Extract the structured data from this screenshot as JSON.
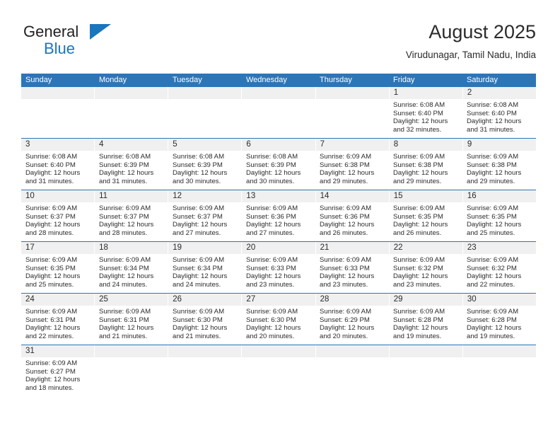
{
  "brand": {
    "name_part1": "General",
    "name_part2": "Blue",
    "triangle_color": "#1a76bc"
  },
  "header": {
    "title": "August 2025",
    "subtitle": "Virudunagar, Tamil Nadu, India"
  },
  "theme": {
    "header_blue": "#2e75b6",
    "date_band_gray": "#f0f0f0",
    "text": "#2b2b2b"
  },
  "weekdays": [
    "Sunday",
    "Monday",
    "Tuesday",
    "Wednesday",
    "Thursday",
    "Friday",
    "Saturday"
  ],
  "weeks": [
    {
      "days": [
        {
          "date": "",
          "sunrise": "",
          "sunset": "",
          "daylight_line1": "",
          "daylight_line2": ""
        },
        {
          "date": "",
          "sunrise": "",
          "sunset": "",
          "daylight_line1": "",
          "daylight_line2": ""
        },
        {
          "date": "",
          "sunrise": "",
          "sunset": "",
          "daylight_line1": "",
          "daylight_line2": ""
        },
        {
          "date": "",
          "sunrise": "",
          "sunset": "",
          "daylight_line1": "",
          "daylight_line2": ""
        },
        {
          "date": "",
          "sunrise": "",
          "sunset": "",
          "daylight_line1": "",
          "daylight_line2": ""
        },
        {
          "date": "1",
          "sunrise": "Sunrise: 6:08 AM",
          "sunset": "Sunset: 6:40 PM",
          "daylight_line1": "Daylight: 12 hours",
          "daylight_line2": "and 32 minutes."
        },
        {
          "date": "2",
          "sunrise": "Sunrise: 6:08 AM",
          "sunset": "Sunset: 6:40 PM",
          "daylight_line1": "Daylight: 12 hours",
          "daylight_line2": "and 31 minutes."
        }
      ]
    },
    {
      "days": [
        {
          "date": "3",
          "sunrise": "Sunrise: 6:08 AM",
          "sunset": "Sunset: 6:40 PM",
          "daylight_line1": "Daylight: 12 hours",
          "daylight_line2": "and 31 minutes."
        },
        {
          "date": "4",
          "sunrise": "Sunrise: 6:08 AM",
          "sunset": "Sunset: 6:39 PM",
          "daylight_line1": "Daylight: 12 hours",
          "daylight_line2": "and 31 minutes."
        },
        {
          "date": "5",
          "sunrise": "Sunrise: 6:08 AM",
          "sunset": "Sunset: 6:39 PM",
          "daylight_line1": "Daylight: 12 hours",
          "daylight_line2": "and 30 minutes."
        },
        {
          "date": "6",
          "sunrise": "Sunrise: 6:08 AM",
          "sunset": "Sunset: 6:39 PM",
          "daylight_line1": "Daylight: 12 hours",
          "daylight_line2": "and 30 minutes."
        },
        {
          "date": "7",
          "sunrise": "Sunrise: 6:09 AM",
          "sunset": "Sunset: 6:38 PM",
          "daylight_line1": "Daylight: 12 hours",
          "daylight_line2": "and 29 minutes."
        },
        {
          "date": "8",
          "sunrise": "Sunrise: 6:09 AM",
          "sunset": "Sunset: 6:38 PM",
          "daylight_line1": "Daylight: 12 hours",
          "daylight_line2": "and 29 minutes."
        },
        {
          "date": "9",
          "sunrise": "Sunrise: 6:09 AM",
          "sunset": "Sunset: 6:38 PM",
          "daylight_line1": "Daylight: 12 hours",
          "daylight_line2": "and 29 minutes."
        }
      ]
    },
    {
      "days": [
        {
          "date": "10",
          "sunrise": "Sunrise: 6:09 AM",
          "sunset": "Sunset: 6:37 PM",
          "daylight_line1": "Daylight: 12 hours",
          "daylight_line2": "and 28 minutes."
        },
        {
          "date": "11",
          "sunrise": "Sunrise: 6:09 AM",
          "sunset": "Sunset: 6:37 PM",
          "daylight_line1": "Daylight: 12 hours",
          "daylight_line2": "and 28 minutes."
        },
        {
          "date": "12",
          "sunrise": "Sunrise: 6:09 AM",
          "sunset": "Sunset: 6:37 PM",
          "daylight_line1": "Daylight: 12 hours",
          "daylight_line2": "and 27 minutes."
        },
        {
          "date": "13",
          "sunrise": "Sunrise: 6:09 AM",
          "sunset": "Sunset: 6:36 PM",
          "daylight_line1": "Daylight: 12 hours",
          "daylight_line2": "and 27 minutes."
        },
        {
          "date": "14",
          "sunrise": "Sunrise: 6:09 AM",
          "sunset": "Sunset: 6:36 PM",
          "daylight_line1": "Daylight: 12 hours",
          "daylight_line2": "and 26 minutes."
        },
        {
          "date": "15",
          "sunrise": "Sunrise: 6:09 AM",
          "sunset": "Sunset: 6:35 PM",
          "daylight_line1": "Daylight: 12 hours",
          "daylight_line2": "and 26 minutes."
        },
        {
          "date": "16",
          "sunrise": "Sunrise: 6:09 AM",
          "sunset": "Sunset: 6:35 PM",
          "daylight_line1": "Daylight: 12 hours",
          "daylight_line2": "and 25 minutes."
        }
      ]
    },
    {
      "days": [
        {
          "date": "17",
          "sunrise": "Sunrise: 6:09 AM",
          "sunset": "Sunset: 6:35 PM",
          "daylight_line1": "Daylight: 12 hours",
          "daylight_line2": "and 25 minutes."
        },
        {
          "date": "18",
          "sunrise": "Sunrise: 6:09 AM",
          "sunset": "Sunset: 6:34 PM",
          "daylight_line1": "Daylight: 12 hours",
          "daylight_line2": "and 24 minutes."
        },
        {
          "date": "19",
          "sunrise": "Sunrise: 6:09 AM",
          "sunset": "Sunset: 6:34 PM",
          "daylight_line1": "Daylight: 12 hours",
          "daylight_line2": "and 24 minutes."
        },
        {
          "date": "20",
          "sunrise": "Sunrise: 6:09 AM",
          "sunset": "Sunset: 6:33 PM",
          "daylight_line1": "Daylight: 12 hours",
          "daylight_line2": "and 23 minutes."
        },
        {
          "date": "21",
          "sunrise": "Sunrise: 6:09 AM",
          "sunset": "Sunset: 6:33 PM",
          "daylight_line1": "Daylight: 12 hours",
          "daylight_line2": "and 23 minutes."
        },
        {
          "date": "22",
          "sunrise": "Sunrise: 6:09 AM",
          "sunset": "Sunset: 6:32 PM",
          "daylight_line1": "Daylight: 12 hours",
          "daylight_line2": "and 23 minutes."
        },
        {
          "date": "23",
          "sunrise": "Sunrise: 6:09 AM",
          "sunset": "Sunset: 6:32 PM",
          "daylight_line1": "Daylight: 12 hours",
          "daylight_line2": "and 22 minutes."
        }
      ]
    },
    {
      "days": [
        {
          "date": "24",
          "sunrise": "Sunrise: 6:09 AM",
          "sunset": "Sunset: 6:31 PM",
          "daylight_line1": "Daylight: 12 hours",
          "daylight_line2": "and 22 minutes."
        },
        {
          "date": "25",
          "sunrise": "Sunrise: 6:09 AM",
          "sunset": "Sunset: 6:31 PM",
          "daylight_line1": "Daylight: 12 hours",
          "daylight_line2": "and 21 minutes."
        },
        {
          "date": "26",
          "sunrise": "Sunrise: 6:09 AM",
          "sunset": "Sunset: 6:30 PM",
          "daylight_line1": "Daylight: 12 hours",
          "daylight_line2": "and 21 minutes."
        },
        {
          "date": "27",
          "sunrise": "Sunrise: 6:09 AM",
          "sunset": "Sunset: 6:30 PM",
          "daylight_line1": "Daylight: 12 hours",
          "daylight_line2": "and 20 minutes."
        },
        {
          "date": "28",
          "sunrise": "Sunrise: 6:09 AM",
          "sunset": "Sunset: 6:29 PM",
          "daylight_line1": "Daylight: 12 hours",
          "daylight_line2": "and 20 minutes."
        },
        {
          "date": "29",
          "sunrise": "Sunrise: 6:09 AM",
          "sunset": "Sunset: 6:28 PM",
          "daylight_line1": "Daylight: 12 hours",
          "daylight_line2": "and 19 minutes."
        },
        {
          "date": "30",
          "sunrise": "Sunrise: 6:09 AM",
          "sunset": "Sunset: 6:28 PM",
          "daylight_line1": "Daylight: 12 hours",
          "daylight_line2": "and 19 minutes."
        }
      ]
    },
    {
      "days": [
        {
          "date": "31",
          "sunrise": "Sunrise: 6:09 AM",
          "sunset": "Sunset: 6:27 PM",
          "daylight_line1": "Daylight: 12 hours",
          "daylight_line2": "and 18 minutes."
        },
        {
          "date": "",
          "sunrise": "",
          "sunset": "",
          "daylight_line1": "",
          "daylight_line2": ""
        },
        {
          "date": "",
          "sunrise": "",
          "sunset": "",
          "daylight_line1": "",
          "daylight_line2": ""
        },
        {
          "date": "",
          "sunrise": "",
          "sunset": "",
          "daylight_line1": "",
          "daylight_line2": ""
        },
        {
          "date": "",
          "sunrise": "",
          "sunset": "",
          "daylight_line1": "",
          "daylight_line2": ""
        },
        {
          "date": "",
          "sunrise": "",
          "sunset": "",
          "daylight_line1": "",
          "daylight_line2": ""
        },
        {
          "date": "",
          "sunrise": "",
          "sunset": "",
          "daylight_line1": "",
          "daylight_line2": ""
        }
      ]
    }
  ]
}
